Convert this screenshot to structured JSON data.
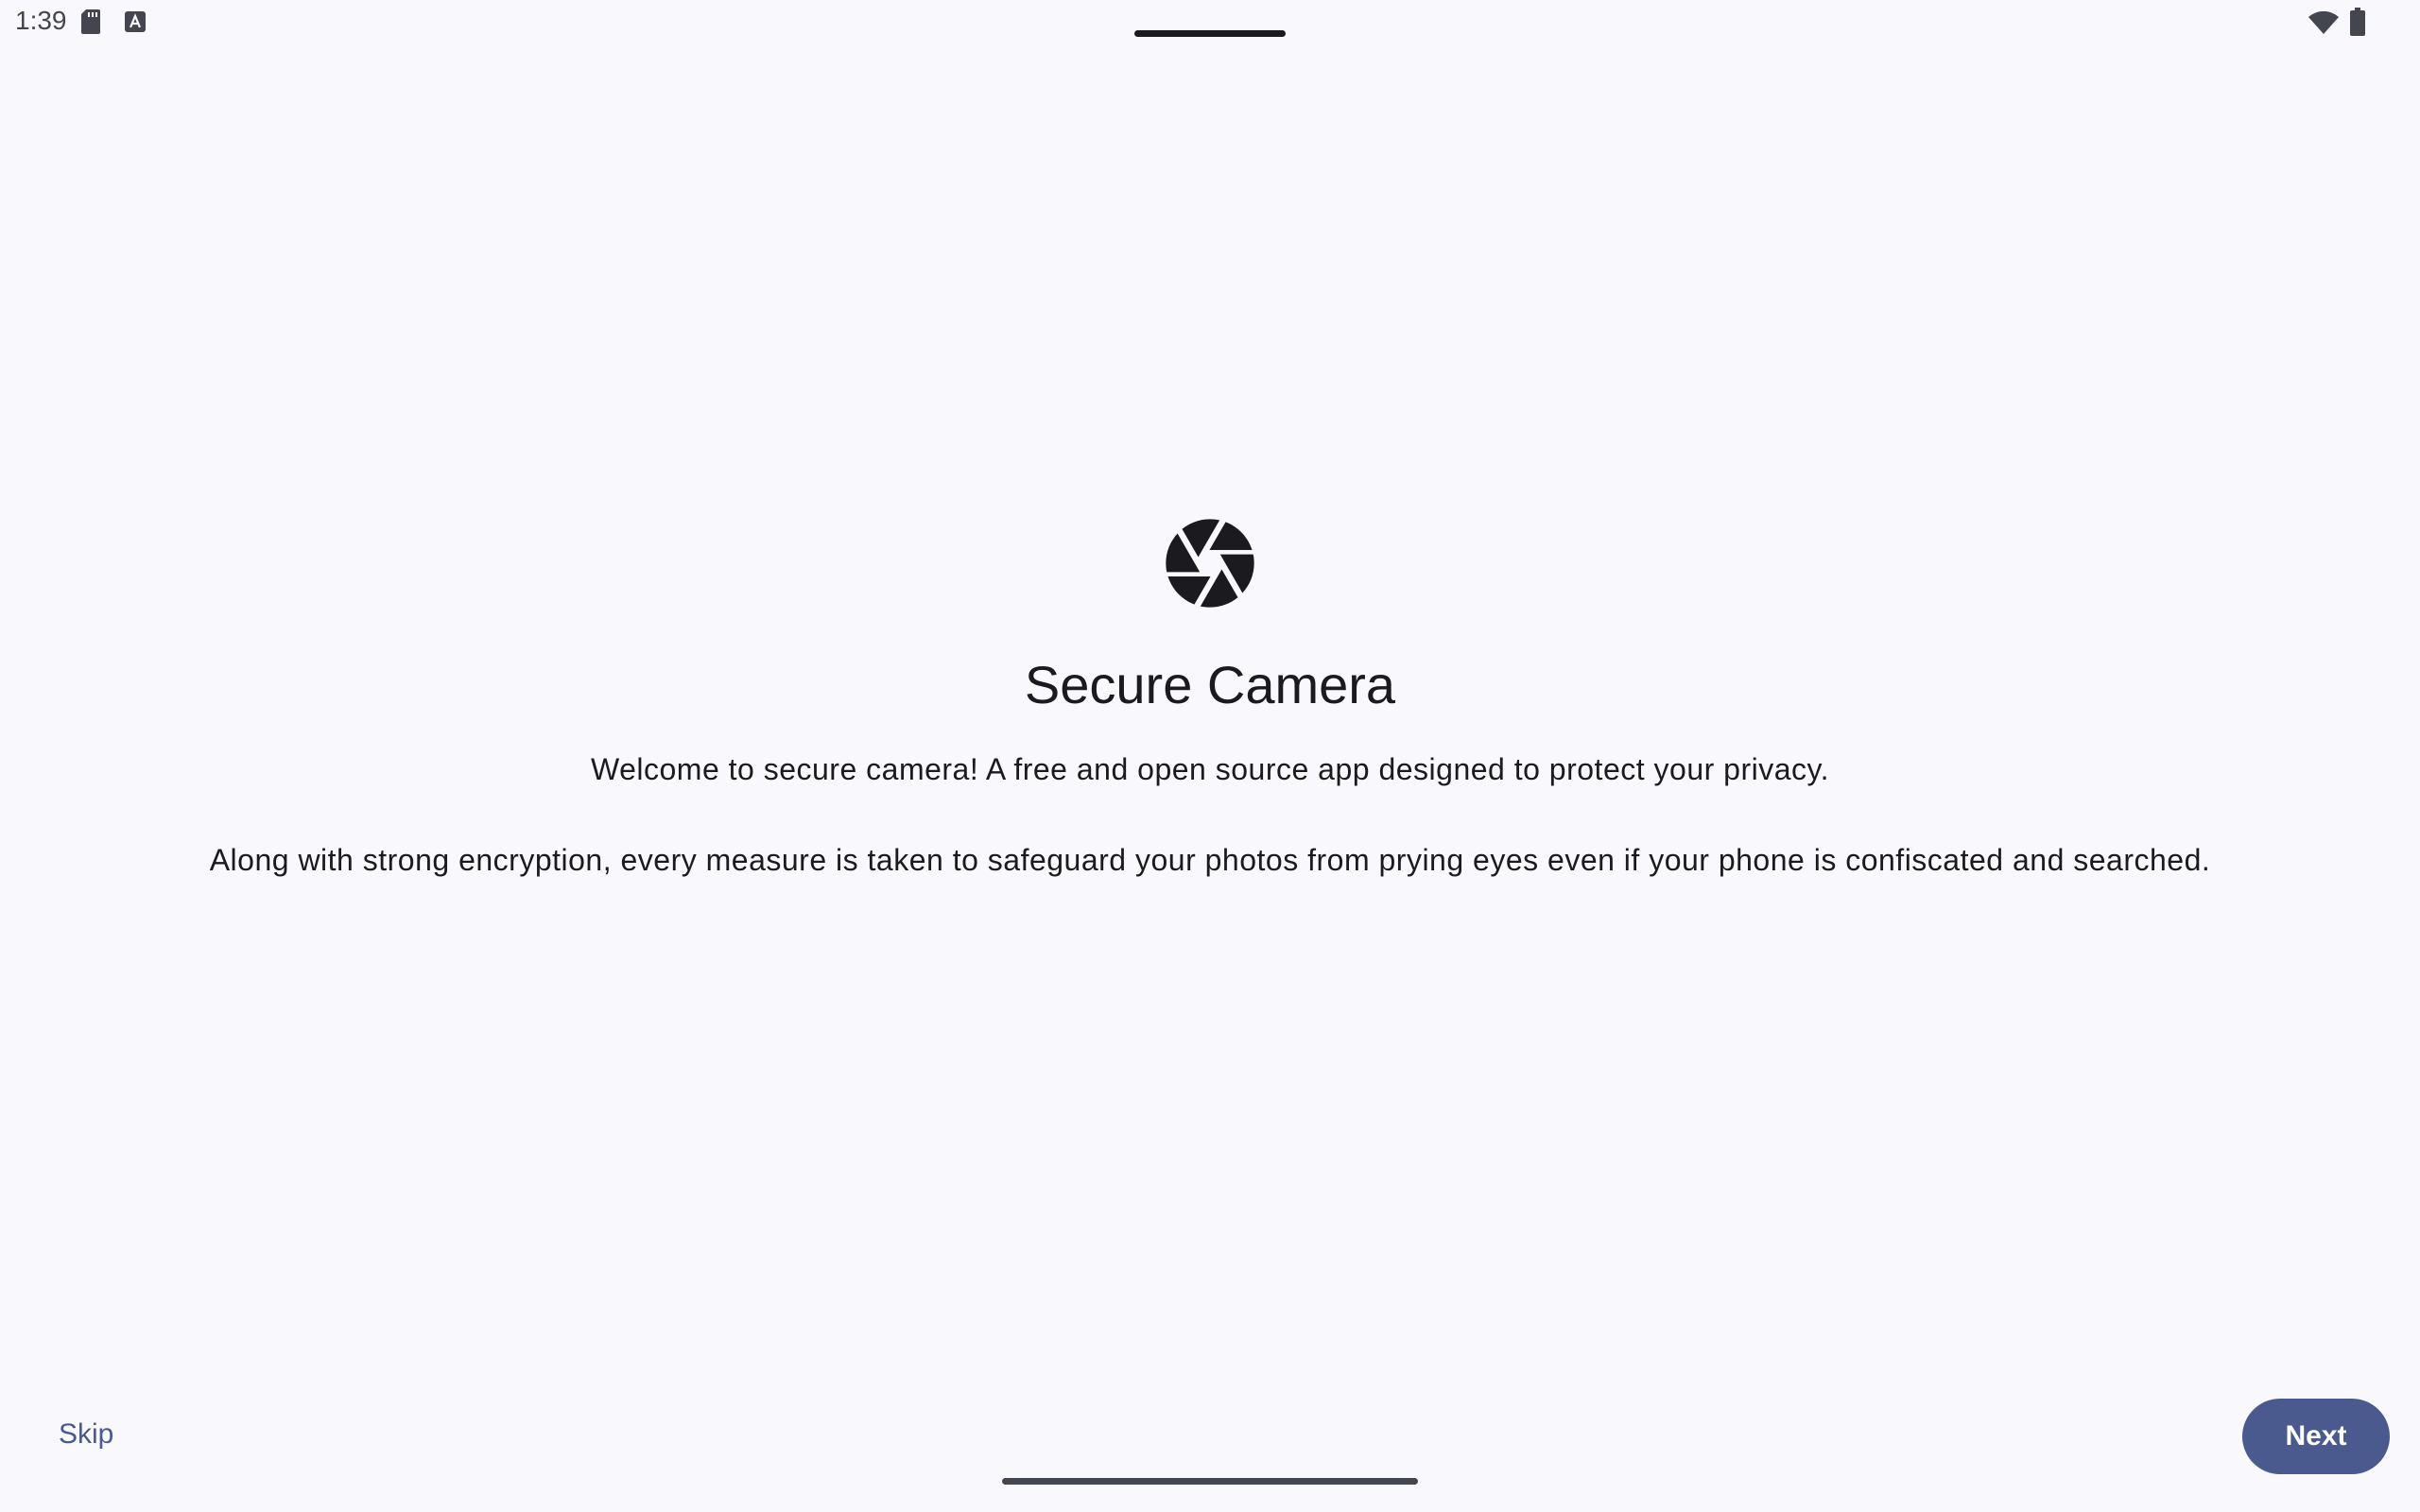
{
  "status_bar": {
    "time": "1:39",
    "icons": [
      "sd-card-icon",
      "keyboard-icon",
      "wifi-icon",
      "battery-icon"
    ]
  },
  "app": {
    "logo_icon": "camera-aperture-icon",
    "title": "Secure Camera",
    "paragraph_1": "Welcome to secure camera! A free and open source app designed to protect your privacy.",
    "paragraph_2": "Along with strong encryption, every measure is taken to safeguard your photos from prying eyes even if your phone is confiscated and searched."
  },
  "actions": {
    "skip_label": "Skip",
    "next_label": "Next"
  },
  "colors": {
    "background": "#f8f8fd",
    "primary": "#4a5a8e",
    "text": "#1b1b1f"
  }
}
